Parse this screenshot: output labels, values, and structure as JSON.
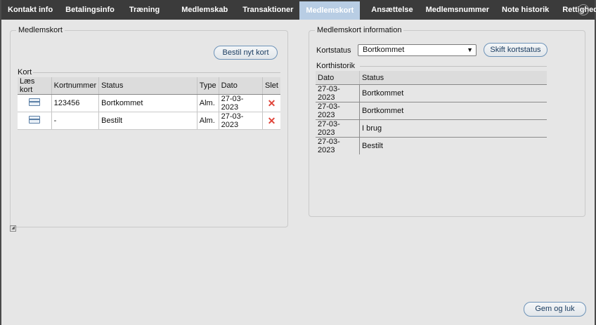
{
  "tabs": [
    {
      "label": "Kontakt info"
    },
    {
      "label": "Betalingsinfo"
    },
    {
      "label": "Træning"
    },
    {
      "label": "Medlemskab"
    },
    {
      "label": "Transaktioner"
    },
    {
      "label": "Medlemskort",
      "active": true
    },
    {
      "label": "Ansættelse"
    },
    {
      "label": "Medlemsnummer"
    },
    {
      "label": "Note historik"
    },
    {
      "label": "Rettigheder"
    }
  ],
  "left_group": {
    "title": "Medlemskort",
    "order_button": "Bestil nyt kort",
    "section_label": "Kort",
    "columns": [
      "Læs kort",
      "Kortnummer",
      "Status",
      "Type",
      "Dato",
      "Slet"
    ],
    "rows": [
      {
        "card_number": "123456",
        "status": "Bortkommet",
        "type": "Alm.",
        "date": "27-03-2023"
      },
      {
        "card_number": "-",
        "status": "Bestilt",
        "type": "Alm.",
        "date": "27-03-2023"
      }
    ]
  },
  "right_group": {
    "title": "Medlemskort information",
    "status_label": "Kortstatus",
    "status_value": "Bortkommet",
    "change_button": "Skift kortstatus",
    "history_label": "Korthistorik",
    "history_columns": [
      "Dato",
      "Status"
    ],
    "history_rows": [
      {
        "date": "27-03-2023",
        "status": "Bortkommet"
      },
      {
        "date": "27-03-2023",
        "status": "Bortkommet"
      },
      {
        "date": "27-03-2023",
        "status": "I brug"
      },
      {
        "date": "27-03-2023",
        "status": "Bestilt"
      }
    ]
  },
  "save_button": "Gem og luk",
  "icons": {
    "read_card": "card-reader-icon",
    "delete": "delete-x-icon",
    "more": "more-options-icon"
  },
  "colors": {
    "active_tab": "#b8cde4",
    "tab_bar": "#3b3b3b",
    "delete": "#e0443a"
  }
}
